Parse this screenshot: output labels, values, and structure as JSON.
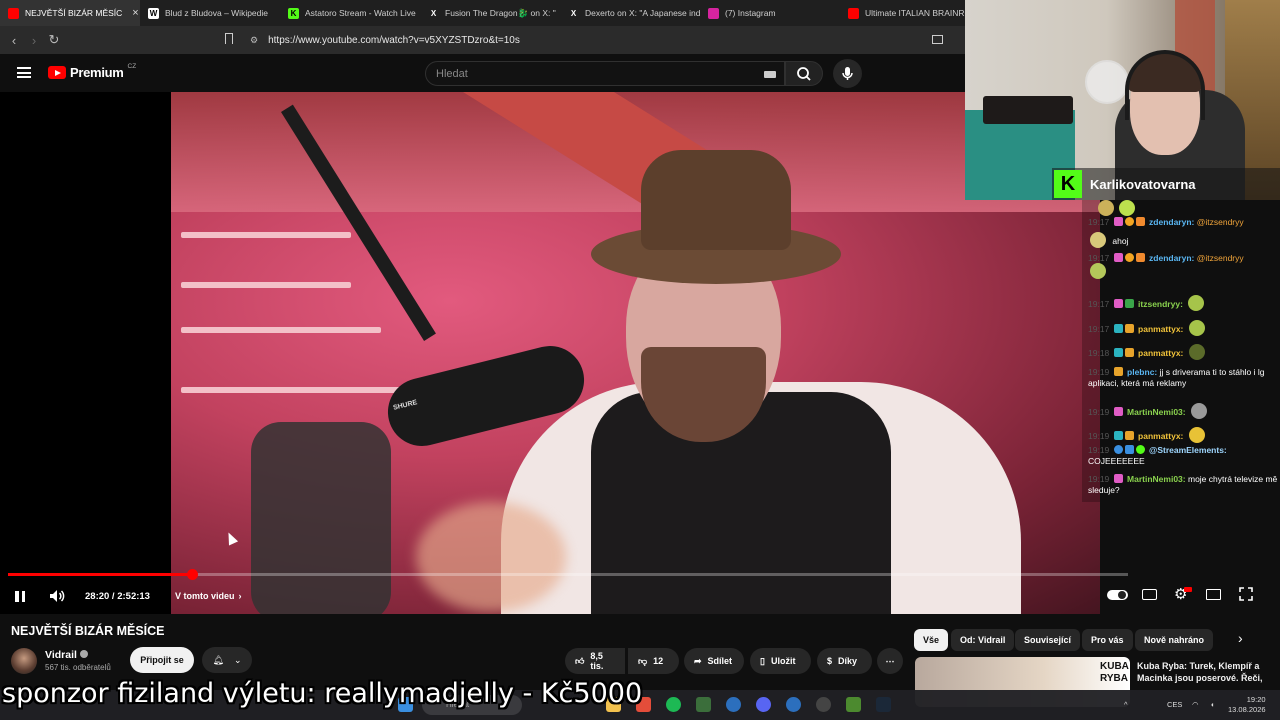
{
  "browser": {
    "tabs": [
      {
        "label": "NEJVĚTŠÍ BIZÁR MĚSÍC",
        "color": "#ff0000",
        "active": true
      },
      {
        "label": "Blud z Bludova – Wikipedie",
        "color": "#ffffff",
        "active": false
      },
      {
        "label": "Astatoro Stream - Watch Live",
        "color": "#53fc18",
        "active": false
      },
      {
        "label": "Fusion The Dragon🐉 on X: \"",
        "color": "#000000",
        "active": false
      },
      {
        "label": "Dexerto on X: \"A Japanese ind",
        "color": "#000000",
        "active": false
      },
      {
        "label": "(7) Instagram",
        "color": "#d6249f",
        "active": false
      },
      {
        "label": "Ultimate ITALIAN BRAINROT",
        "color": "#ff0000",
        "active": false
      }
    ],
    "url": "https://www.youtube.com/watch?v=v5XYZSTDzro&t=10s"
  },
  "youtube": {
    "logo_text": "Premium",
    "logo_country": "CZ",
    "search_placeholder": "Hledat"
  },
  "player": {
    "timecode": "28:20 / 2:52:13",
    "chapter": "V tomto videu",
    "progress_fraction": 0.164,
    "mic_brand": "SHURE"
  },
  "video": {
    "title": "NEJVĚTŠÍ BIZÁR MĚSÍCE",
    "channel": "Vidrail",
    "subscribers": "567 tis. odběratelů",
    "subscribe_label": "Připojit se",
    "likes": "8,5 tis.",
    "dislikes": "12",
    "share_label": "Sdílet",
    "save_label": "Uložit",
    "thanks_label": "Díky"
  },
  "chips": [
    "Vše",
    "Od: Vidrail",
    "Související",
    "Pro vás",
    "Nově nahráno"
  ],
  "recommendation": {
    "thumb_text": "KUBA RYBA",
    "title": "Kuba Ryba: Turek, Klempíř a Macinka jsou poserové. Řeči,"
  },
  "overlay": {
    "sponsor": "sponzor fiziland výletu: reallymadjelly - Kč5000",
    "streamer": "Karlikovatovarna"
  },
  "chat": [
    {
      "ts": "",
      "user": "",
      "text": "",
      "emote": true
    },
    {
      "ts": "19:17",
      "user": "zdendaryn:",
      "text": "@itzsendryy",
      "mention": true
    },
    {
      "ts": "",
      "user": "",
      "text": "ahoj"
    },
    {
      "ts": "19:17",
      "user": "zdendaryn:",
      "text": "@itzsendryy",
      "mention": true
    },
    {
      "ts": "19:17",
      "user": "itzsendryy:",
      "text": ""
    },
    {
      "ts": "19:17",
      "user": "panmattyx:",
      "text": ""
    },
    {
      "ts": "19:18",
      "user": "panmattyx:",
      "text": ""
    },
    {
      "ts": "19:19",
      "user": "plebnc:",
      "text": "jj s driverama ti to stáhlo i lg aplikaci, která má reklamy"
    },
    {
      "ts": "19:19",
      "user": "MartinNemi03:",
      "text": ""
    },
    {
      "ts": "19:19",
      "user": "panmattyx:",
      "text": ""
    },
    {
      "ts": "19:19",
      "user": "@StreamElements:",
      "text": "COJEEEEEEE"
    },
    {
      "ts": "19:19",
      "user": "MartinNemi03:",
      "text": "moje chytrá televize mě sleduje?"
    }
  ],
  "taskbar": {
    "search_placeholder": "Hledat",
    "language": "CES",
    "time": "19:20",
    "date": "13.08.2026"
  }
}
